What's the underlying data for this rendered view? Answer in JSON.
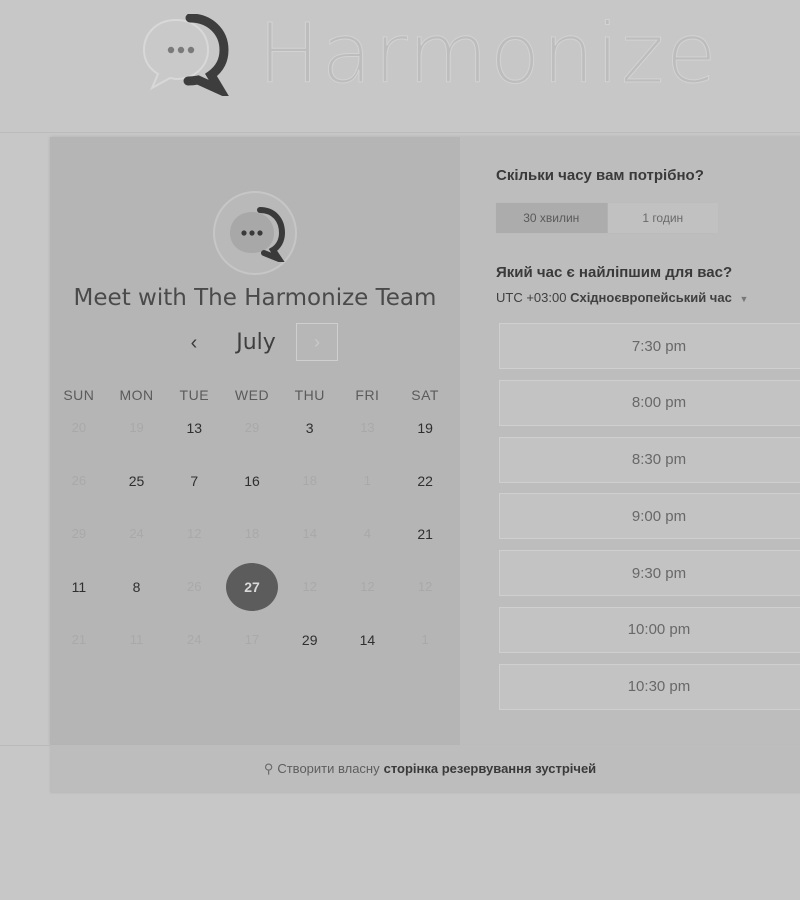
{
  "brand": {
    "name": "Harmonize",
    "logo_icon": "chat-bubble-logo-icon"
  },
  "calendar": {
    "title": "Meet with The Harmonize Team",
    "month": "July",
    "prev_symbol": "‹",
    "next_symbol": "›",
    "weekdays": [
      "SUN",
      "MON",
      "TUE",
      "WED",
      "THU",
      "FRI",
      "SAT"
    ],
    "weeks": [
      [
        {
          "d": "20",
          "s": "muted"
        },
        {
          "d": "19",
          "s": "muted"
        },
        {
          "d": "13",
          "s": "avail"
        },
        {
          "d": "29",
          "s": "muted"
        },
        {
          "d": "3",
          "s": "avail"
        },
        {
          "d": "13",
          "s": "muted"
        },
        {
          "d": "19",
          "s": "avail"
        }
      ],
      [
        {
          "d": "26",
          "s": "muted"
        },
        {
          "d": "25",
          "s": "avail"
        },
        {
          "d": "7",
          "s": "avail"
        },
        {
          "d": "16",
          "s": "avail"
        },
        {
          "d": "18",
          "s": "muted"
        },
        {
          "d": "1",
          "s": "muted"
        },
        {
          "d": "22",
          "s": "avail"
        }
      ],
      [
        {
          "d": "29",
          "s": "muted"
        },
        {
          "d": "24",
          "s": "muted"
        },
        {
          "d": "12",
          "s": "muted"
        },
        {
          "d": "18",
          "s": "muted"
        },
        {
          "d": "14",
          "s": "muted"
        },
        {
          "d": "4",
          "s": "muted"
        },
        {
          "d": "21",
          "s": "avail"
        }
      ],
      [
        {
          "d": "11",
          "s": "avail"
        },
        {
          "d": "8",
          "s": "avail"
        },
        {
          "d": "26",
          "s": "muted"
        },
        {
          "d": "27",
          "s": "selected"
        },
        {
          "d": "12",
          "s": "muted"
        },
        {
          "d": "12",
          "s": "muted"
        },
        {
          "d": "12",
          "s": "muted"
        }
      ],
      [
        {
          "d": "21",
          "s": "muted"
        },
        {
          "d": "11",
          "s": "muted"
        },
        {
          "d": "24",
          "s": "muted"
        },
        {
          "d": "17",
          "s": "muted"
        },
        {
          "d": "29",
          "s": "avail"
        },
        {
          "d": "14",
          "s": "avail"
        },
        {
          "d": "1",
          "s": "muted"
        }
      ]
    ]
  },
  "booking": {
    "duration_question": "Скільки часу вам потрібно?",
    "durations": [
      {
        "label": "30 хвилин",
        "active": true
      },
      {
        "label": "1 годин",
        "active": false
      }
    ],
    "time_question": "Який час є найліпшим для вас?",
    "timezone_offset": "UTC +03:00",
    "timezone_name": "Східноєвропейський час",
    "slots": [
      "7:30 pm",
      "8:00 pm",
      "8:30 pm",
      "9:00 pm",
      "9:30 pm",
      "10:00 pm",
      "10:30 pm"
    ]
  },
  "footer": {
    "prefix": "Створити власну",
    "link": "сторінка резервування зустрічей",
    "icon": "hubspot-sprocket-icon"
  },
  "colors": {
    "background": "#c7c7c7",
    "selected_day": "#5c5c5c"
  }
}
